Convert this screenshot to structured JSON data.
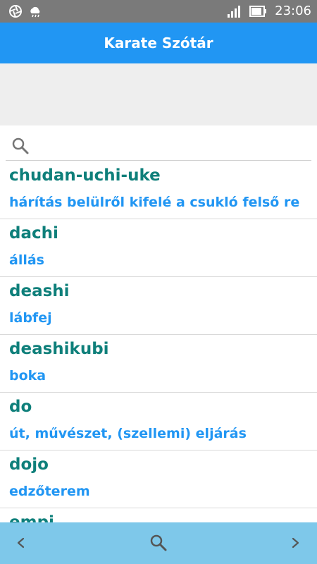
{
  "status_bar": {
    "time": "23:06",
    "icons": [
      "aperture-icon",
      "cloud-icon",
      "signal-icon",
      "battery-icon"
    ]
  },
  "app_bar": {
    "title": "Karate Szótár"
  },
  "search": {
    "placeholder": "",
    "value": ""
  },
  "entries": [
    {
      "term": "chudan-uchi-uke",
      "definition": "hárítás belülről kifelé a csukló felső re"
    },
    {
      "term": "dachi",
      "definition": "állás"
    },
    {
      "term": "deashi",
      "definition": "lábfej"
    },
    {
      "term": "deashikubi",
      "definition": "boka"
    },
    {
      "term": "do",
      "definition": "út, művészet, (szellemi) eljárás"
    },
    {
      "term": "dojo",
      "definition": "edzőterem"
    },
    {
      "term": "empi",
      "definition": ""
    }
  ],
  "bottom_nav": {
    "icons": [
      "chevron-left-icon",
      "search-icon",
      "chevron-right-icon"
    ]
  },
  "colors": {
    "app_bar": "#2196f3",
    "term": "#0e7f7a",
    "definition": "#2196f3",
    "bottom_bar": "#7ec8ea",
    "status_bar": "#7a7a7a"
  }
}
